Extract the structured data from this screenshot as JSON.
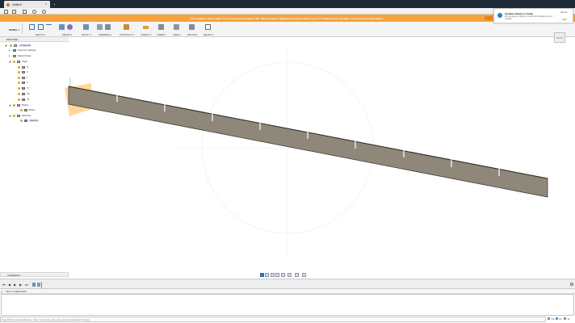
{
  "window": {
    "tab_title": "Untitled*",
    "close_glyph": "×",
    "add_tab_glyph": "+"
  },
  "banner": {
    "text": "Your graphics driver might not be supported in Fusion 360. Open Graphics Diagnostic from the Help menu (\"?\" button) in the top right corner for more information.",
    "color": "#f7a33d"
  },
  "ribbon": {
    "workspace": "MODEL ▾",
    "groups": [
      {
        "label": "SKETCH ▾"
      },
      {
        "label": "CREATE ▾"
      },
      {
        "label": "MODIFY ▾"
      },
      {
        "label": "ASSEMBLE ▾"
      },
      {
        "label": "CONSTRUCT ▾"
      },
      {
        "label": "INSPECT ▾"
      },
      {
        "label": "INSERT ▾"
      },
      {
        "label": "MAKE ▾"
      },
      {
        "label": "ADD-INS ▾"
      },
      {
        "label": "SELECT ▾"
      }
    ]
  },
  "browser": {
    "title": "BROWSER",
    "items": [
      {
        "label": "(Unsaved)",
        "level": 0
      },
      {
        "label": "Document Settings",
        "level": 1
      },
      {
        "label": "Named Views",
        "level": 1
      },
      {
        "label": "Origin",
        "level": 1
      },
      {
        "label": "O",
        "level": 2
      },
      {
        "label": "X",
        "level": 2
      },
      {
        "label": "Y",
        "level": 2
      },
      {
        "label": "Z",
        "level": 2
      },
      {
        "label": "XY",
        "level": 2
      },
      {
        "label": "XZ",
        "level": 2
      },
      {
        "label": "YZ",
        "level": 2
      },
      {
        "label": "Bodies",
        "level": 1
      },
      {
        "label": "Body1",
        "level": 2
      },
      {
        "label": "Sketches",
        "level": 1
      },
      {
        "label": "Sketch1",
        "level": 2
      }
    ]
  },
  "notification": {
    "title": "Updates Ready to Install",
    "body": "We just want to restart to install these updates now or tonight?",
    "primary_label": "Restart",
    "secondary_label": "Later",
    "accent": "#2d7fc1"
  },
  "comments": {
    "title": "COMMENTS"
  },
  "text_commands": {
    "title": "TEXT COMMANDS",
    "placeholder": "Type Python Commands here - Type \"Import neu_dev; neu_dev.list_functions()\" for help",
    "modes": [
      "Txt",
      "Py",
      "Js"
    ],
    "selected_mode": "Py"
  },
  "viewcube": {
    "label": "FRONT"
  },
  "icons": {
    "app": "fusion-logo-icon",
    "grid": "app-grid-icon",
    "file": "file-icon",
    "save": "save-icon",
    "undo": "undo-icon",
    "redo": "redo-icon"
  },
  "colors": {
    "body_fill": "#8f887a",
    "body_edge": "#3d3a35",
    "highlight": "#ffb44a",
    "accent": "#2d7fc1"
  }
}
